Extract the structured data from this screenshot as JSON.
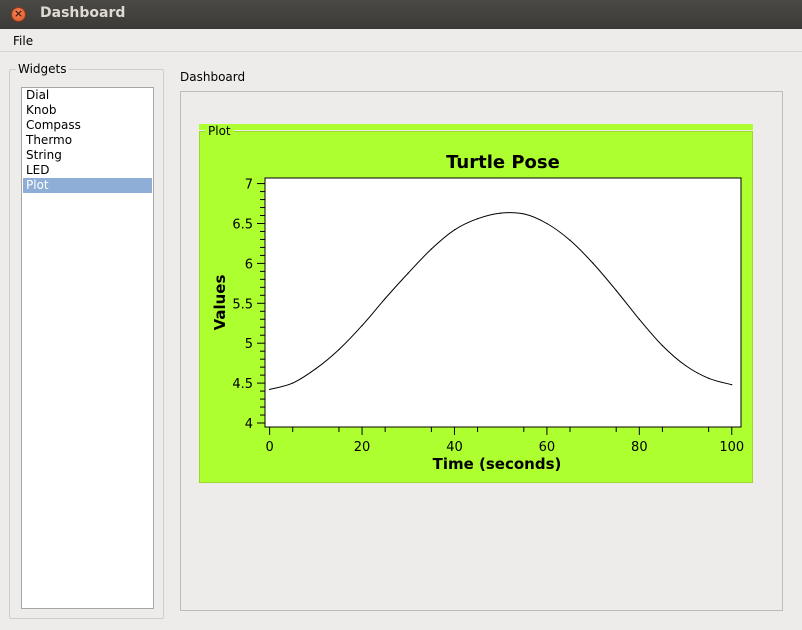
{
  "window": {
    "title": "Dashboard"
  },
  "menu": {
    "file": "File"
  },
  "widgets": {
    "group_title": "Widgets",
    "items": [
      "Dial",
      "Knob",
      "Compass",
      "Thermo",
      "String",
      "LED",
      "Plot"
    ],
    "selected": "Plot"
  },
  "dashboard": {
    "label": "Dashboard"
  },
  "plot_panel": {
    "label": "Plot"
  },
  "colors": {
    "plot_background": "#adff2f",
    "selection": "#8eaed8"
  },
  "chart_data": {
    "type": "line",
    "title": "Turtle Pose",
    "xlabel": "Time (seconds)",
    "ylabel": "Values",
    "xlim": [
      -1,
      102
    ],
    "ylim": [
      3.95,
      7.07
    ],
    "xticks": [
      0,
      20,
      40,
      60,
      80,
      100
    ],
    "yticks": [
      4,
      4.5,
      5,
      5.5,
      6,
      6.5,
      7
    ],
    "ytick_labels": [
      "4",
      "4.5",
      "5",
      "5.5",
      "6",
      "6.5",
      "7"
    ],
    "grid": false,
    "series": [
      {
        "x": [
          0,
          5,
          10,
          15,
          20,
          25,
          30,
          35,
          40,
          45,
          50,
          55,
          60,
          65,
          70,
          75,
          80,
          85,
          90,
          95,
          100
        ],
        "y": [
          4.42,
          4.5,
          4.68,
          4.92,
          5.22,
          5.56,
          5.88,
          6.18,
          6.42,
          6.56,
          6.63,
          6.62,
          6.5,
          6.29,
          6.0,
          5.66,
          5.3,
          4.97,
          4.72,
          4.56,
          4.48
        ]
      }
    ]
  }
}
